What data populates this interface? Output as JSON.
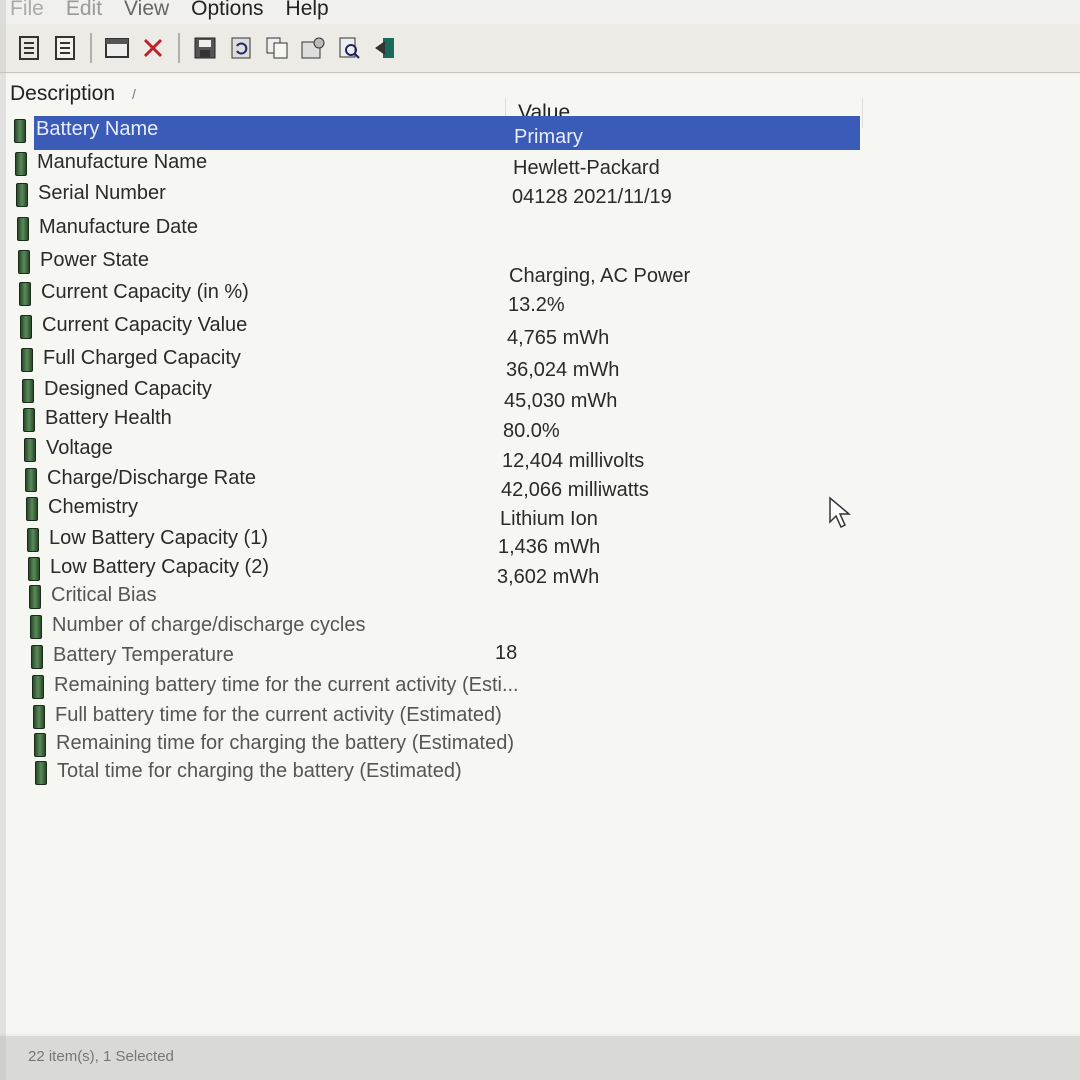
{
  "menu": [
    "File",
    "Edit",
    "View",
    "Options",
    "Help"
  ],
  "toolbar": {
    "icons": [
      "properties-icon",
      "html-report-icon",
      "window-icon",
      "delete-icon",
      "save-icon",
      "refresh-icon",
      "copy-icon",
      "options-icon",
      "find-icon",
      "exit-icon"
    ]
  },
  "list": {
    "header_description": "Description",
    "header_value": "Value",
    "rows": [
      {
        "description": "Battery Name",
        "value": "Primary",
        "selected": true
      },
      {
        "description": "Manufacture Name",
        "value": "Hewlett-Packard"
      },
      {
        "description": "Serial Number",
        "value": "04128 2021/11/19"
      },
      {
        "description": "Manufacture Date",
        "value": ""
      },
      {
        "description": "Power State",
        "value": "Charging, AC Power"
      },
      {
        "description": "Current Capacity (in %)",
        "value": "13.2%"
      },
      {
        "description": "Current Capacity Value",
        "value": "4,765 mWh"
      },
      {
        "description": "Full Charged Capacity",
        "value": "36,024 mWh"
      },
      {
        "description": "Designed Capacity",
        "value": "45,030 mWh"
      },
      {
        "description": "Battery Health",
        "value": "80.0%"
      },
      {
        "description": "Voltage",
        "value": "12,404 millivolts"
      },
      {
        "description": "Charge/Discharge Rate",
        "value": "42,066 milliwatts"
      },
      {
        "description": "Chemistry",
        "value": "Lithium Ion"
      },
      {
        "description": "Low Battery Capacity (1)",
        "value": "1,436 mWh"
      },
      {
        "description": "Low Battery Capacity (2)",
        "value": "3,602 mWh"
      },
      {
        "description": "Critical Bias",
        "value": ""
      },
      {
        "description": "Number of charge/discharge cycles",
        "value": "18"
      },
      {
        "description": "Battery Temperature",
        "value": ""
      },
      {
        "description": "Remaining battery time for the current activity (Esti...",
        "value": ""
      },
      {
        "description": "Full battery time for the current activity (Estimated)",
        "value": ""
      },
      {
        "description": "Remaining time for charging the battery (Estimated)",
        "value": ""
      },
      {
        "description": "Total  time for charging the battery (Estimated)",
        "value": ""
      }
    ]
  },
  "status": "22 item(s), 1 Selected"
}
